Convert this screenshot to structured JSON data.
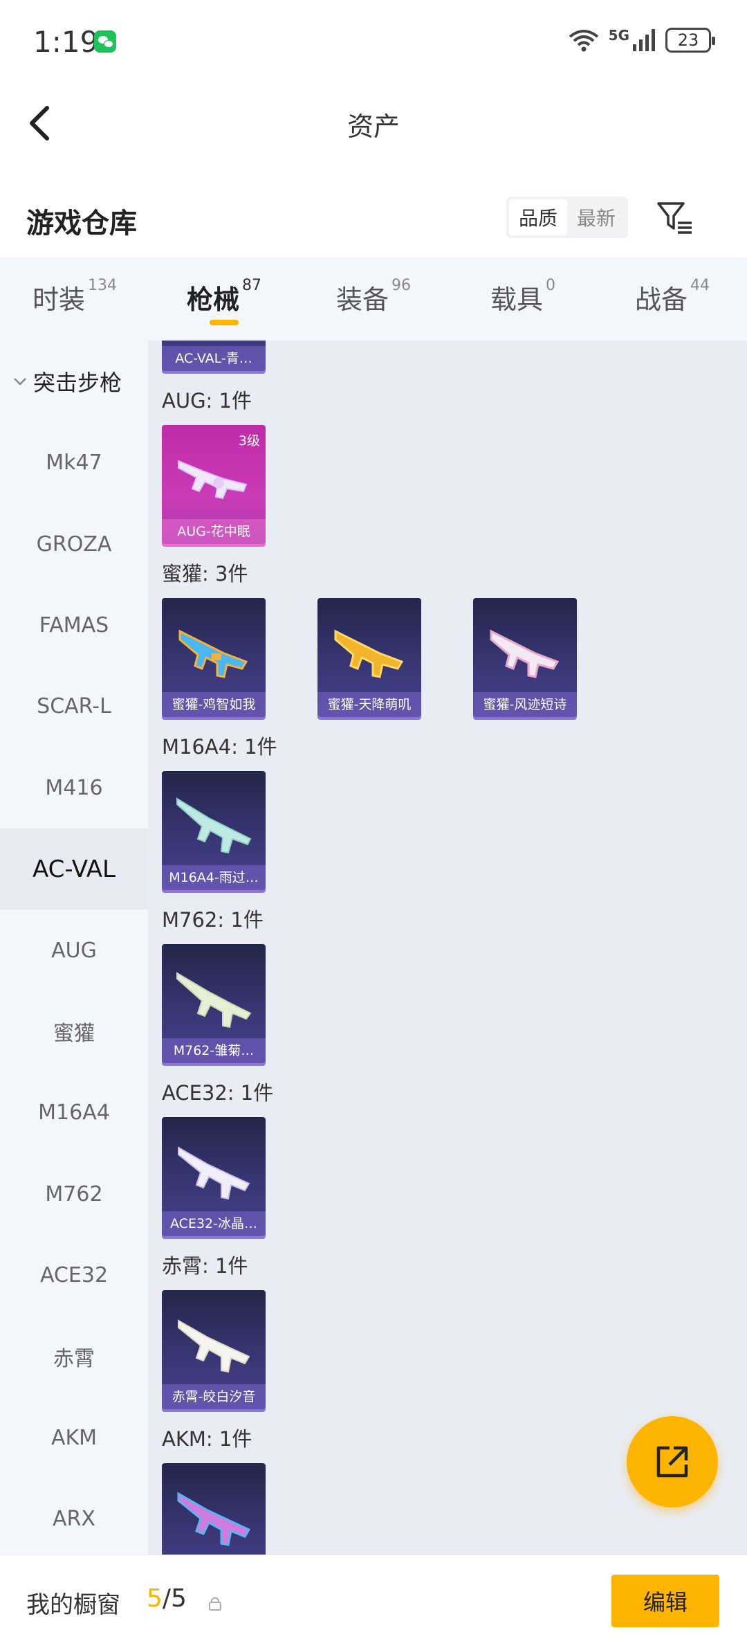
{
  "status_bar": {
    "time": "1:19",
    "battery": "23",
    "network": "5G"
  },
  "nav": {
    "title": "资产"
  },
  "warehouse": {
    "title": "游戏仓库",
    "sort_options": [
      "品质",
      "最新"
    ]
  },
  "tabs": [
    {
      "label": "时装",
      "count": "134"
    },
    {
      "label": "枪械",
      "count": "87"
    },
    {
      "label": "装备",
      "count": "96"
    },
    {
      "label": "载具",
      "count": "0"
    },
    {
      "label": "战备",
      "count": "44"
    }
  ],
  "sidebar": {
    "group": "突击步枪",
    "items": [
      "Mk47",
      "GROZA",
      "FAMAS",
      "SCAR-L",
      "M416",
      "AC-VAL",
      "AUG",
      "蜜獾",
      "M16A4",
      "M762",
      "ACE32",
      "赤霄",
      "AKM",
      "ARX"
    ],
    "active": "AC-VAL"
  },
  "groups": [
    {
      "label": "AUG: 1件",
      "items": [
        {
          "name": "AUG-花中眠",
          "level": "3级",
          "color": "#d03cb8"
        }
      ]
    },
    {
      "label": "蜜獾: 3件",
      "items": [
        {
          "name": "蜜獾-鸡智如我"
        },
        {
          "name": "蜜獾-天降萌叽"
        },
        {
          "name": "蜜獾-风迹短诗"
        }
      ]
    },
    {
      "label": "M16A4: 1件",
      "items": [
        {
          "name": "M16A4-雨过…"
        }
      ]
    },
    {
      "label": "M762: 1件",
      "items": [
        {
          "name": "M762-雏菊…"
        }
      ]
    },
    {
      "label": "ACE32: 1件",
      "items": [
        {
          "name": "ACE32-冰晶…"
        }
      ]
    },
    {
      "label": "赤霄: 1件",
      "items": [
        {
          "name": "赤霄-皎白汐音"
        }
      ]
    },
    {
      "label": "AKM: 1件",
      "items": [
        {
          "name": ""
        }
      ]
    }
  ],
  "partial_top_card": "AC-VAL-青…",
  "bottom_bar": {
    "label": "我的橱窗",
    "current": "5",
    "total": "/5",
    "edit": "编辑"
  },
  "colors": {
    "accent": "#ffb400"
  }
}
